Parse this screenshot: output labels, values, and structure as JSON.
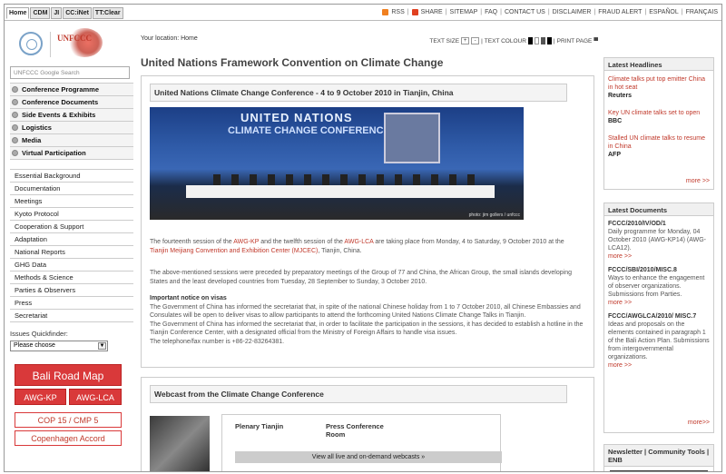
{
  "top_tabs": [
    "Home",
    "CDM",
    "JI",
    "CC:iNet",
    "TT:Clear"
  ],
  "top_links": [
    "RSS",
    "SHARE",
    "SITEMAP",
    "FAQ",
    "CONTACT US",
    "DISCLAIMER",
    "FRAUD ALERT",
    "ESPAÑOL",
    "FRANÇAIS"
  ],
  "logo_text": "UNFCCC",
  "search_placeholder": "UNFCCC Google Search",
  "menu_primary": [
    "Conference Programme",
    "Conference Documents",
    "Side Events & Exhibits",
    "Logistics",
    "Media",
    "Virtual Participation"
  ],
  "menu_secondary": [
    "Essential Background",
    "Documentation",
    "Meetings",
    "Kyoto Protocol",
    "Cooperation & Support",
    "Adaptation",
    "National Reports",
    "GHG Data",
    "Methods & Science",
    "Parties & Observers",
    "Press",
    "Secretariat"
  ],
  "quickfinder": {
    "label": "Issues Quickfinder:",
    "selected": "Please choose"
  },
  "promo": {
    "bali": "Bali Road Map",
    "awg_kp": "AWG-KP",
    "awg_lca": "AWG-LCA",
    "cop": "COP 15 / CMP 5",
    "copenhagen": "Copenhagen Accord"
  },
  "location": "Your location: Home",
  "text_size_label": "TEXT SIZE",
  "text_colour_label": "TEXT COLOUR",
  "print_label": "PRINT PAGE",
  "page_title": "United Nations Framework Convention on Climate Change",
  "feature": {
    "heading": "United Nations Climate Change Conference - 4 to 9 October 2010 in Tianjin, China",
    "banner_en": "UNITED NATIONS",
    "banner_en2": "CLIMATE CHANGE CONFERENCE",
    "photo_credit": "photo: jim gollers / unfccc",
    "p1_a": "The fourteenth session of the ",
    "p1_link1": "AWG-KP",
    "p1_b": " and the twelfth session of the ",
    "p1_link2": "AWG-LCA",
    "p1_c": " are taking place from Monday, 4 to Saturday, 9 October 2010 at the ",
    "p1_link3": "Tianjin Meijiang Convention and Exhibition Center (MJCEC)",
    "p1_d": ", Tianjin, China.",
    "p2": "The above-mentioned sessions were preceded by preparatory meetings of the Group of 77 and China, the African Group, the small islands developing States and the least developed countries from Tuesday, 28 September to Sunday, 3 October 2010.",
    "notice_title": "Important notice on visas",
    "notice1": "The Government of China has informed the secretariat that, in spite of the national Chinese holiday from 1 to 7 October 2010, all Chinese Embassies and Consulates will be open to deliver visas to allow participants to attend the forthcoming United Nations Climate Change Talks in Tianjin.",
    "notice2": "The Government of China has informed the secretariat that, in order to facilitate the participation in the sessions, it has decided to establish a hotline in the Tianjin Conference Center, with a designated official from the Ministry of Foreign Affairs to handle visa issues.",
    "notice3": "The telephone/fax number is +86-22-83264381."
  },
  "webcast": {
    "heading": "Webcast from the Climate Change Conference",
    "col1": "Plenary Tianjin",
    "col2": "Press Conference Room",
    "button": "View all live and on-demand webcasts »"
  },
  "headlines": {
    "title": "Latest Headlines",
    "items": [
      {
        "title": "Climate talks put top emitter China in hot seat",
        "source": "Reuters"
      },
      {
        "title": "Key UN climate talks set to open",
        "source": "BBC"
      },
      {
        "title": "Stalled UN climate talks to resume in China",
        "source": "AFP"
      }
    ],
    "more": "more >>"
  },
  "documents": {
    "title": "Latest Documents",
    "items": [
      {
        "code": "FCCC/2010/IV/OD/1",
        "desc": "Daily programme for Monday, 04 October 2010 (AWG-KP14) (AWG-LCA12).",
        "more": "more >>"
      },
      {
        "code": "FCCC/SBI/2010/MISC.8",
        "desc": "Ways to enhance the engagement of observer organizations. Submissions from Parties.",
        "more": "more >>"
      },
      {
        "code": "FCCC/AWGLCA/2010/ MISC.7",
        "desc": "Ideas and proposals on the elements contained in paragraph 1 of the Bali Action Plan. Submissions from intergovernmental organizations.",
        "more": "more >>"
      }
    ],
    "more": "more>>"
  },
  "newsletter": {
    "title": "Newsletter | Community Tools | ENB"
  },
  "colors": {
    "accent_red": "#c0392b",
    "promo_red": "#d9393a"
  }
}
